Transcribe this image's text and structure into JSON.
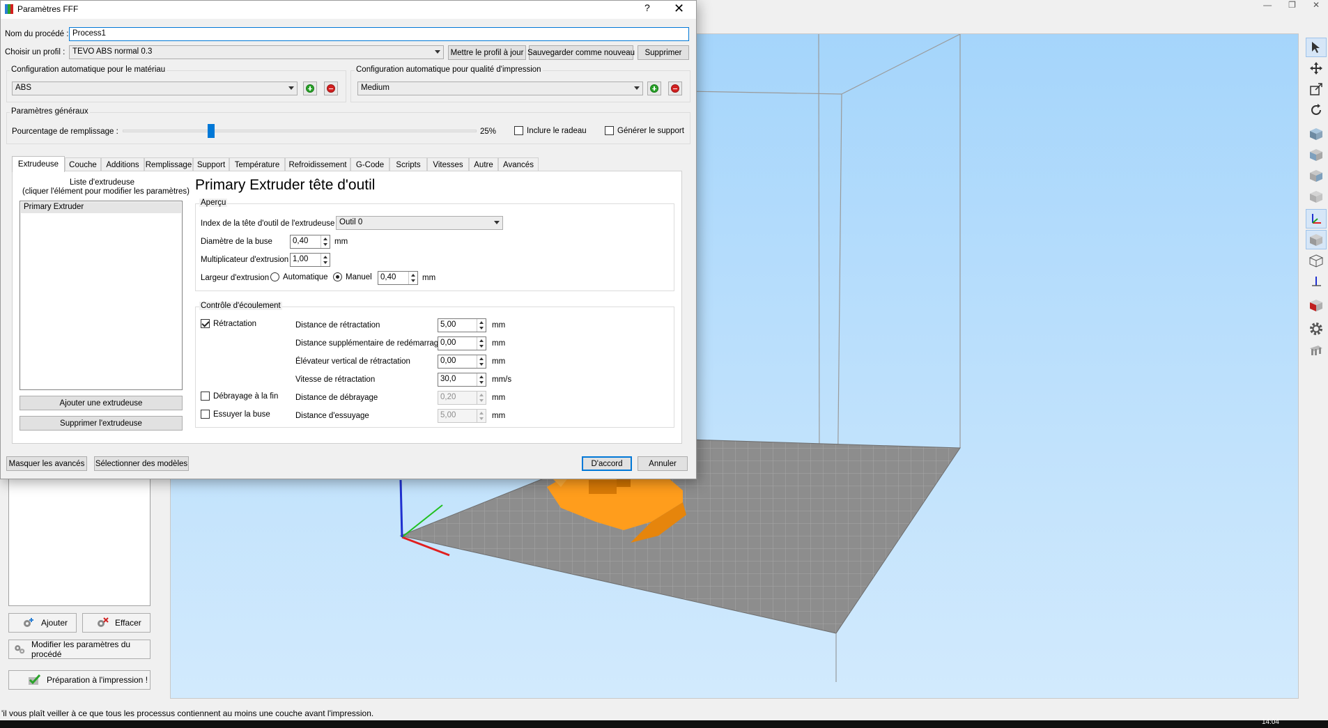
{
  "dialog": {
    "title": "Paramètres FFF",
    "help": "?",
    "close": "✕",
    "process_name_label": "Nom du procédé :",
    "process_name_value": "Process1",
    "profile_label": "Choisir un profil :",
    "profile_value": "TEVO ABS normal 0.3",
    "update_profile_btn": "Mettre le profil à jour",
    "save_new_btn": "Sauvegarder comme nouveau",
    "delete_btn": "Supprimer",
    "material_group_title": "Configuration automatique pour le matériau",
    "material_value": "ABS",
    "quality_group_title": "Configuration automatique pour qualité d'impression",
    "quality_value": "Medium",
    "general_group_title": "Paramètres généraux",
    "infill_label": "Pourcentage de remplissage :",
    "infill_value": "25%",
    "infill_fraction": 0.25,
    "raft_label": "Inclure le radeau",
    "raft_checked": false,
    "support_label": "Générer le support",
    "support_checked": false,
    "tabs": [
      "Extrudeuse",
      "Couche",
      "Additions",
      "Remplissage",
      "Support",
      "Température",
      "Refroidissement",
      "G-Code",
      "Scripts",
      "Vitesses",
      "Autre",
      "Avancés"
    ],
    "active_tab": "Extrudeuse",
    "extruder_list_title_line1": "Liste d'extrudeuse",
    "extruder_list_title_line2": "(cliquer l'élément pour modifier les paramètres)",
    "extruder_list_items": [
      "Primary Extruder"
    ],
    "add_extruder_btn": "Ajouter une extrudeuse",
    "remove_extruder_btn": "Supprimer l'extrudeuse",
    "heading": "Primary Extruder tête d'outil",
    "overview_group_title": "Aperçu",
    "tool_index_label": "Index de la tête d'outil de l'extrudeuse",
    "tool_index_value": "Outil 0",
    "nozzle_diameter_label": "Diamètre de la buse",
    "nozzle_diameter_value": "0,40",
    "nozzle_diameter_unit": "mm",
    "extrusion_multiplier_label": "Multiplicateur d'extrusion",
    "extrusion_multiplier_value": "1,00",
    "extrusion_width_label": "Largeur d'extrusion",
    "extrusion_width_auto_label": "Automatique",
    "extrusion_width_manual_label": "Manuel",
    "extrusion_width_value": "0,40",
    "extrusion_width_unit": "mm",
    "flow_group_title": "Contrôle d'écoulement",
    "retraction_label": "Rétractation",
    "retraction_checked": true,
    "coast_label": "Débrayage à la fin",
    "coast_checked": false,
    "wipe_label": "Essuyer la buse",
    "wipe_checked": false,
    "retraction_distance_label": "Distance de rétractation",
    "retraction_distance_value": "5,00",
    "retraction_distance_unit": "mm",
    "extra_restart_label": "Distance supplémentaire de redémarrage",
    "extra_restart_value": "0,00",
    "extra_restart_unit": "mm",
    "vertical_lift_label": "Élévateur vertical de rétractation",
    "vertical_lift_value": "0,00",
    "vertical_lift_unit": "mm",
    "retraction_speed_label": "Vitesse de rétractation",
    "retraction_speed_value": "30,0",
    "retraction_speed_unit": "mm/s",
    "coast_distance_label": "Distance de débrayage",
    "coast_distance_value": "0,20",
    "coast_distance_unit": "mm",
    "wipe_distance_label": "Distance d'essuyage",
    "wipe_distance_value": "5,00",
    "wipe_distance_unit": "mm",
    "hide_advanced_btn": "Masquer les avancés",
    "select_models_btn": "Sélectionner des modèles",
    "ok_btn": "D'accord",
    "cancel_btn": "Annuler"
  },
  "main": {
    "add_btn": "Ajouter",
    "clear_btn": "Effacer",
    "edit_process_btn": "Modifier les paramètres du procédé",
    "prepare_btn": "Préparation à l'impression !",
    "status_text": "'il vous plaît veiller à ce que tous les processus contiennent au moins une couche avant l'impression.",
    "clock": "14:04"
  },
  "colors": {
    "accent": "#0078d7",
    "sky_top": "#a9d7fb",
    "sky_bottom": "#cde8fd",
    "bed": "#8a8a8a",
    "model": "#ff9d1c"
  },
  "icons": {
    "toolbar": [
      "cursor-icon",
      "move-icon",
      "scale-icon",
      "rotate-icon",
      "view-top-icon",
      "view-front-icon",
      "view-side-icon",
      "view-iso-icon",
      "axes-icon",
      "solid-view-icon",
      "wireframe-icon",
      "axis-arrow-icon",
      "cross-section-icon",
      "settings-gear-icon",
      "bed-icon"
    ]
  }
}
